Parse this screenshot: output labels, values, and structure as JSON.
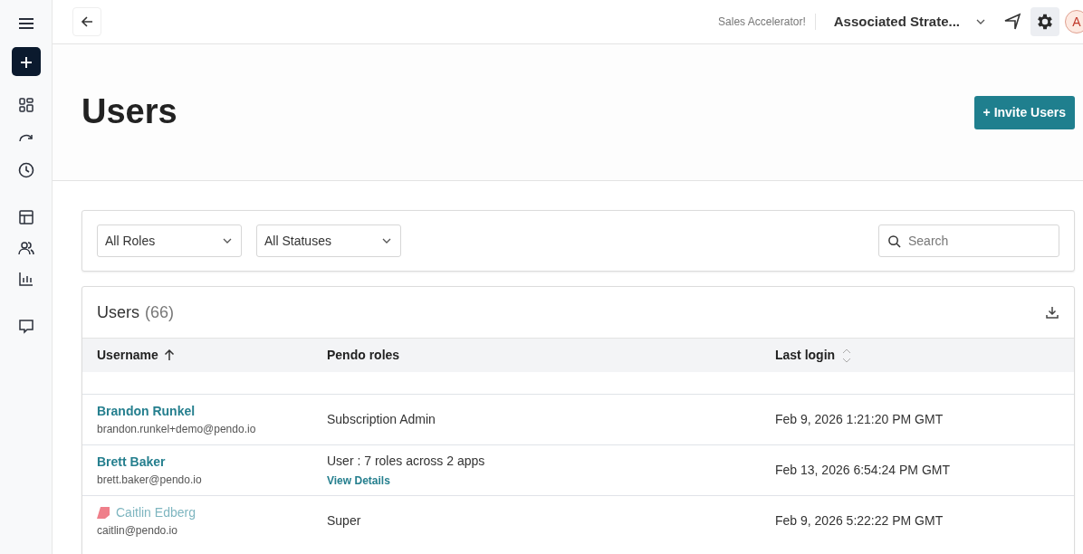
{
  "topbar": {
    "tagline": "Sales Accelerator!",
    "account": "Associated Strate...",
    "avatar": "A"
  },
  "page": {
    "title": "Users",
    "invite_button": "+ Invite Users"
  },
  "filters": {
    "roles": "All Roles",
    "statuses": "All Statuses",
    "search": {
      "placeholder": "Search"
    }
  },
  "table": {
    "title": "Users",
    "count": "(66)",
    "columns": [
      {
        "label": "Username",
        "sortable": true,
        "sorted": true
      },
      {
        "label": "Pendo roles",
        "sortable": false
      },
      {
        "label": "Last login",
        "sortable": true,
        "sorted": false
      }
    ],
    "rows": [
      {
        "kind": "member",
        "name": "Brandon Runkel",
        "email": "brandon.runkel+demo@pendo.io",
        "role": "Subscription Admin",
        "last_login": "Feb 9, 2026 1:21:20 PM GMT"
      },
      {
        "kind": "member",
        "name": "Brett Baker",
        "email": "brett.baker@pendo.io",
        "role": "User : 7 roles across 2 apps",
        "role_link": "View Details",
        "last_login": "Feb 13, 2026 6:54:24 PM GMT"
      },
      {
        "kind": "staff",
        "name": "Caitlin Edberg",
        "email": "caitlin@pendo.io",
        "role": "Super",
        "last_login": "Feb 9, 2026 5:22:22 PM GMT"
      }
    ]
  }
}
